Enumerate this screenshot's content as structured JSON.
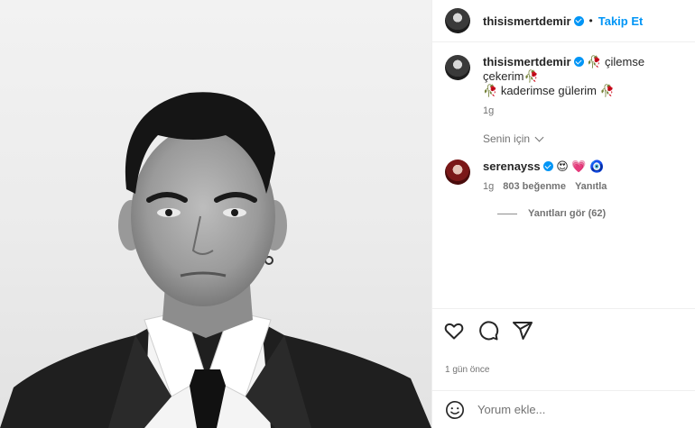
{
  "post": {
    "author": "thisismertdemir",
    "follow_label": "Takip Et",
    "dot": "•"
  },
  "caption": {
    "author": "thisismertdemir",
    "text_part1": "çilemse çekerim",
    "text_part2": "kaderimse gülerim",
    "emoji": "🥀",
    "time": "1g"
  },
  "comments_section": {
    "for_you_label": "Senin için"
  },
  "comment": {
    "author": "serenayss",
    "emojis": "😍 💗 🧿",
    "time": "1g",
    "likes": "803 beğenme",
    "reply_label": "Yanıtla",
    "view_replies": "Yanıtları gör (62)"
  },
  "footer": {
    "time_ago": "1 gün önce",
    "comment_placeholder": "Yorum ekle..."
  },
  "colors": {
    "link": "#0095f6",
    "muted": "#737373",
    "text": "#262626"
  }
}
